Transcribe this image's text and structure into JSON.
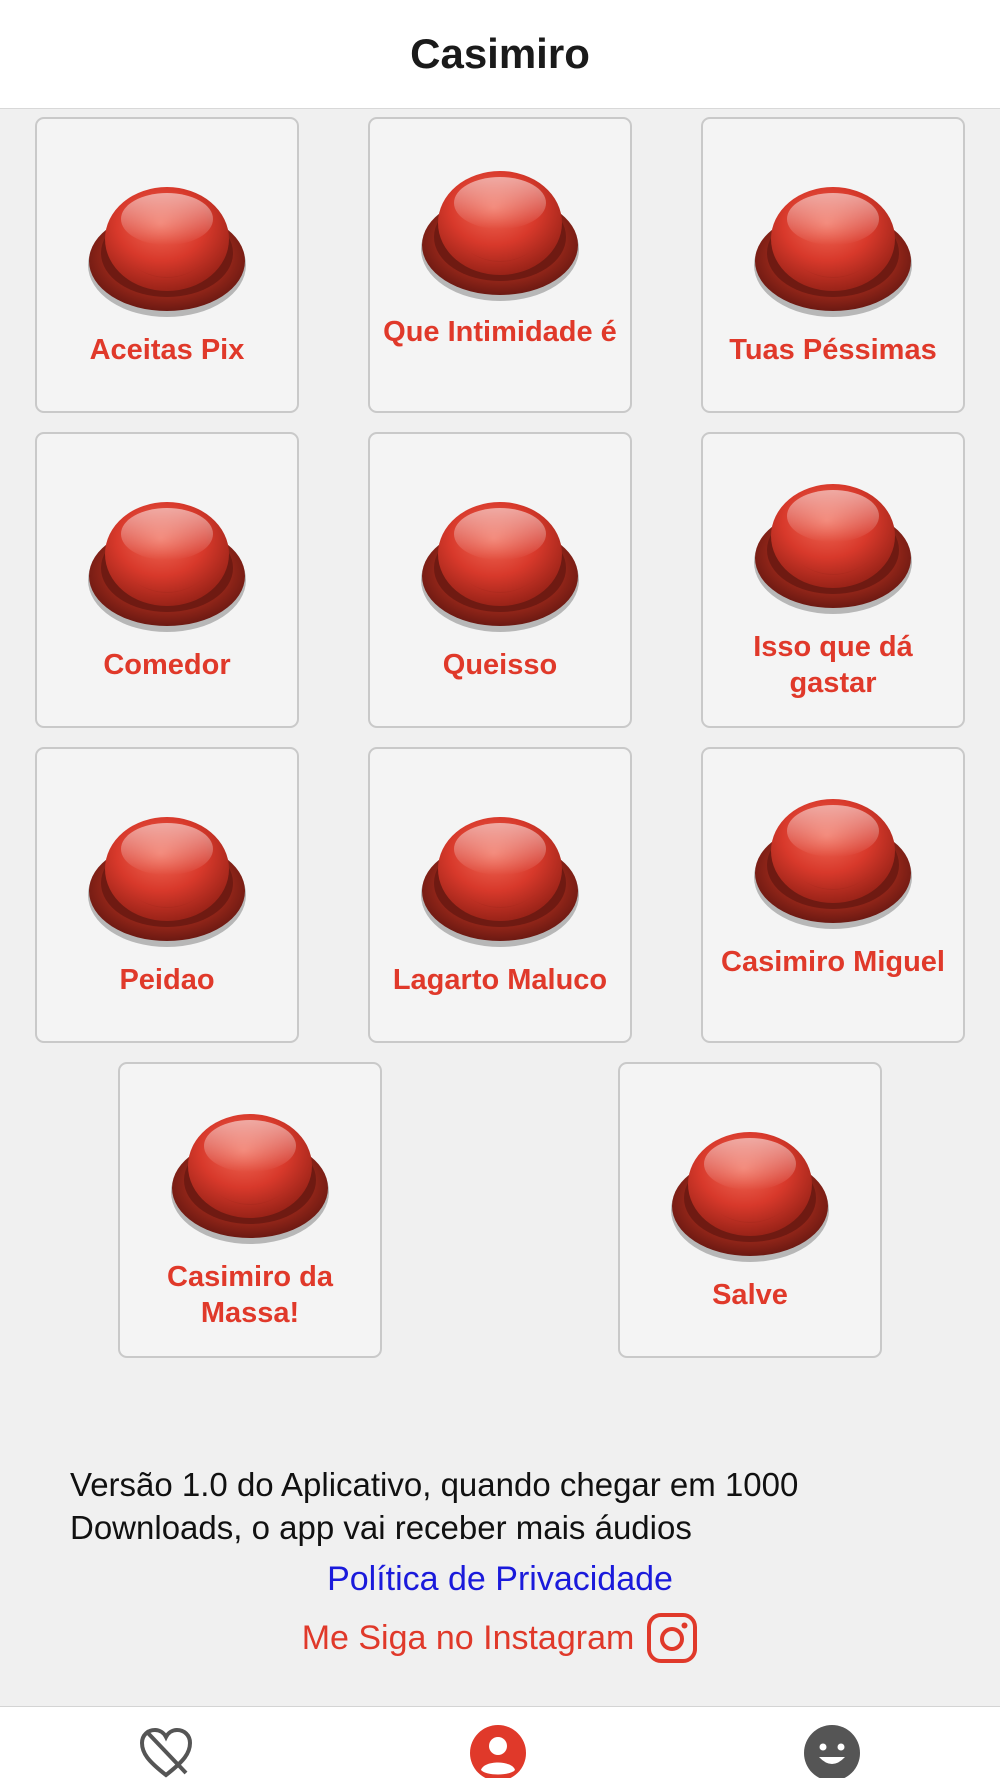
{
  "header": {
    "title": "Casimiro"
  },
  "sounds": [
    {
      "label": "Aceitas Pix"
    },
    {
      "label": "Que Intimidade é"
    },
    {
      "label": "Tuas Péssimas"
    },
    {
      "label": "Comedor"
    },
    {
      "label": "Queisso"
    },
    {
      "label": "Isso que dá gastar"
    },
    {
      "label": "Peidao"
    },
    {
      "label": "Lagarto Maluco"
    },
    {
      "label": "Casimiro Miguel"
    },
    {
      "label": "Casimiro da Massa!"
    },
    {
      "label": "Salve"
    }
  ],
  "footer": {
    "info": "Versão 1.0 do Aplicativo, quando chegar em 1000 Downloads, o app vai receber mais áudios",
    "privacy_link": "Política de Privacidade",
    "instagram_link": "Me Siga no Instagram",
    "instagram_icon": "instagram-icon"
  },
  "tabbar": {
    "tabs": [
      {
        "icon": "heart-off-icon",
        "active": false
      },
      {
        "icon": "person-circle-icon",
        "active": true
      },
      {
        "icon": "smiley-face-icon",
        "active": false
      }
    ]
  },
  "colors": {
    "accent": "#e0392a",
    "link": "#1a1adb",
    "inactive_icon": "#555555"
  }
}
